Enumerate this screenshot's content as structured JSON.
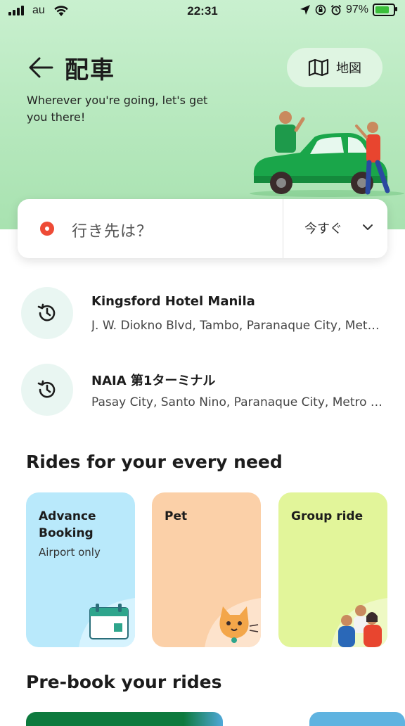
{
  "status_bar": {
    "carrier": "au",
    "time": "22:31",
    "battery_percent": "97%",
    "battery_level": 0.97
  },
  "header": {
    "title": "配車",
    "map_button_label": "地図",
    "subtitle": "Wherever you're going, let's get you there!"
  },
  "search": {
    "placeholder": "行き先は？",
    "time_option": "今すぐ"
  },
  "recent_places": [
    {
      "title": "Kingsford Hotel Manila",
      "address": "J. W. Diokno Blvd, Tambo, Paranaque City, Metro Manila"
    },
    {
      "title": "NAIA 第1ターミナル",
      "address": "Pasay City, Santo Nino, Paranaque City, Metro Manila"
    }
  ],
  "rides_section": {
    "title": "Rides for your every need",
    "cards": [
      {
        "label": "Advance Booking",
        "sub": "Airport only",
        "color": "#b9e9fb"
      },
      {
        "label": "Pet",
        "sub": "",
        "color": "#fbd0a8"
      },
      {
        "label": "Group ride",
        "sub": "",
        "color": "#e2f59a"
      }
    ]
  },
  "prebook_section": {
    "title": "Pre-book your rides"
  },
  "colors": {
    "brand_green": "#00b14f",
    "hero_green": "#b6e8bd",
    "destination_dot": "#ee4b36"
  }
}
